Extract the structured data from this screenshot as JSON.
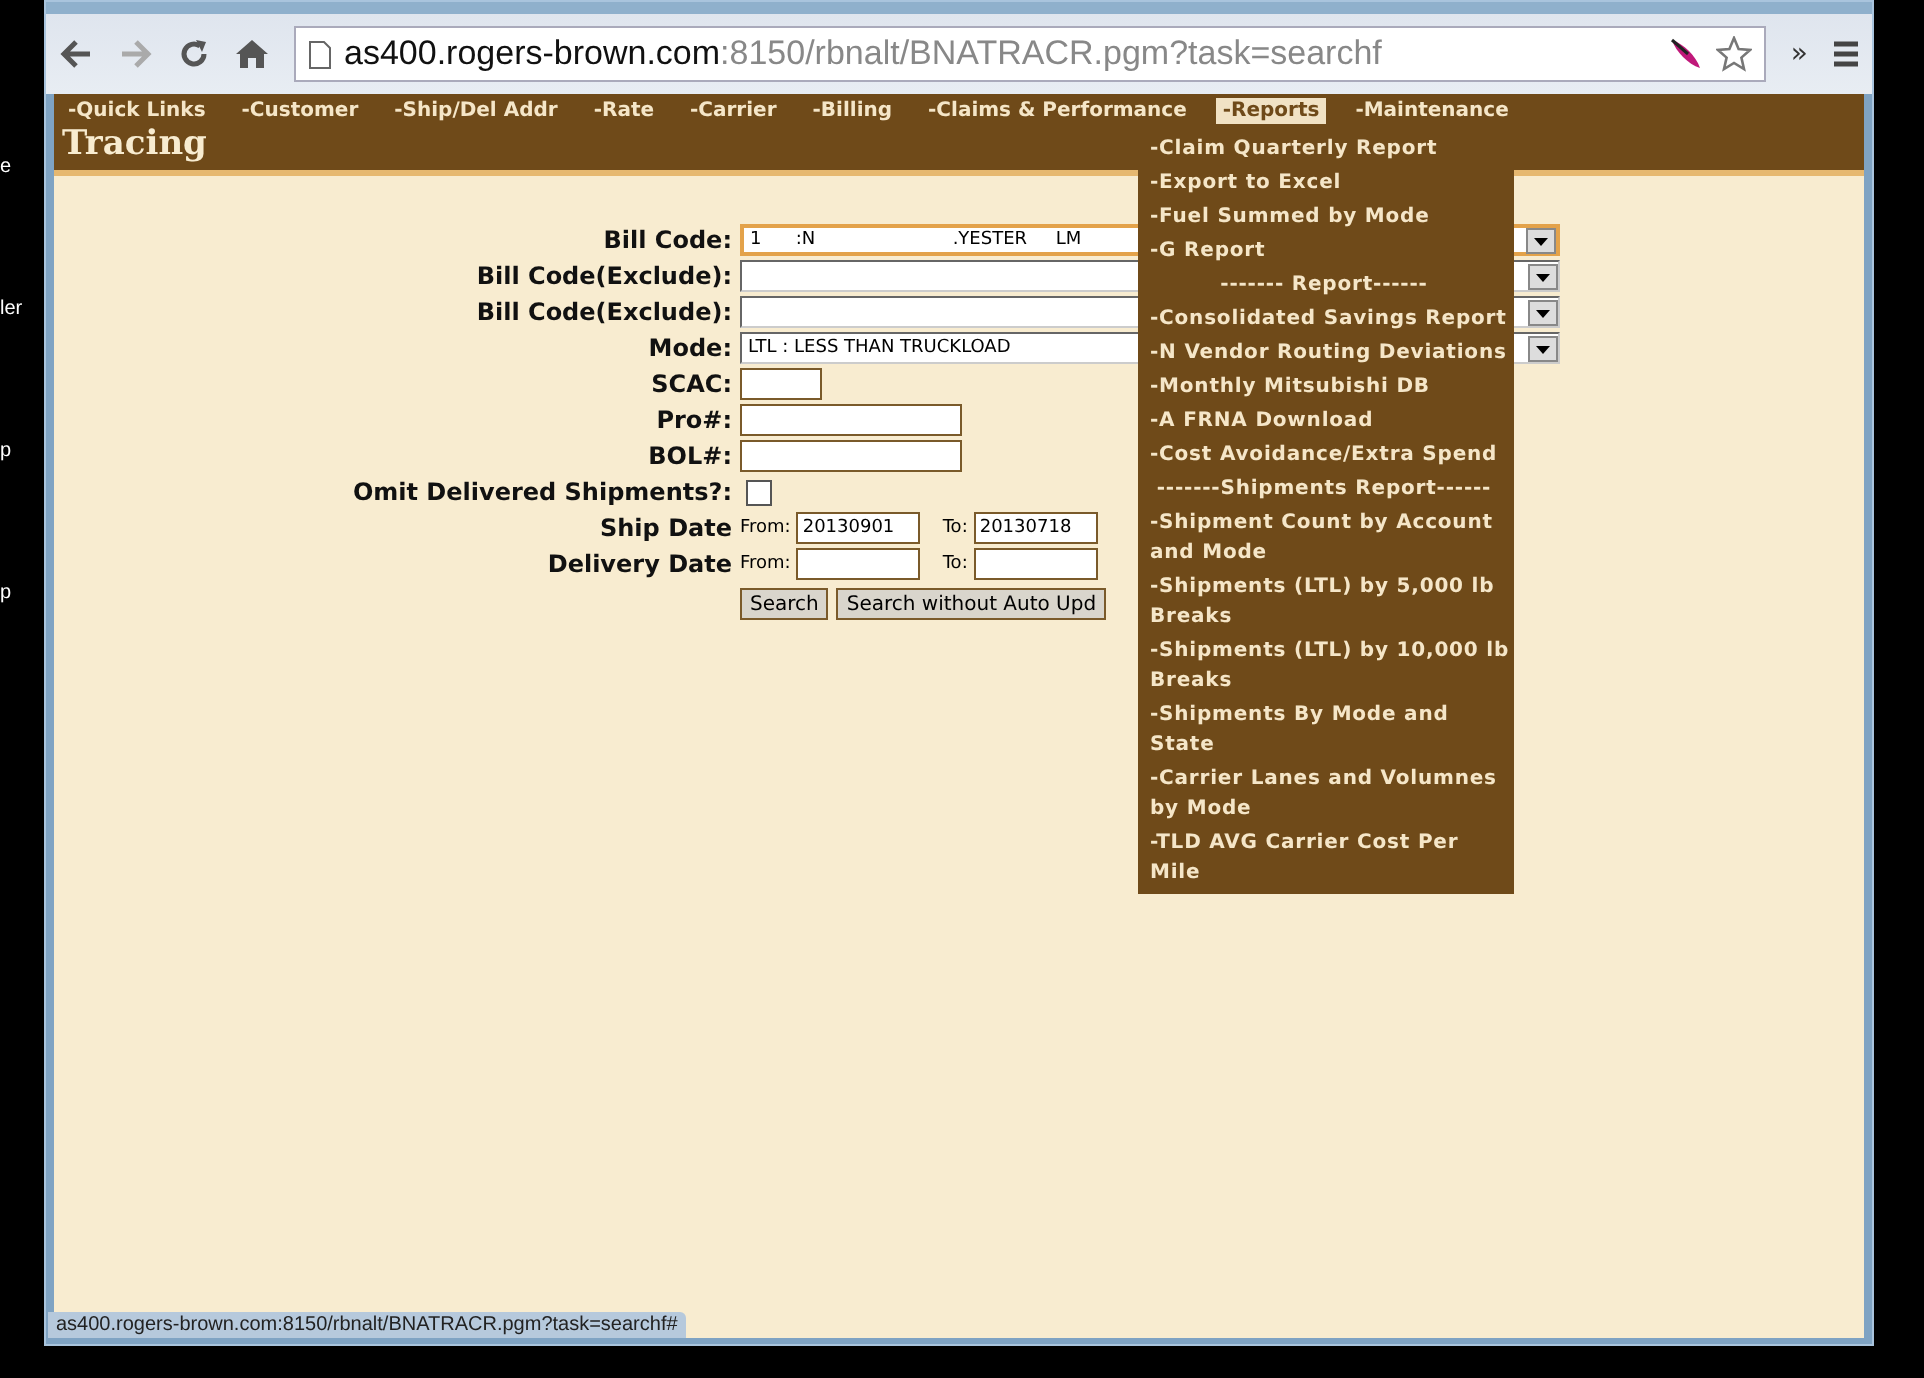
{
  "desktop": {
    "labels": [
      "e",
      "ler",
      "p",
      "p"
    ]
  },
  "browser": {
    "url_host": "as400.rogers-brown.com",
    "url_rest": ":8150/rbnalt/BNATRACR.pgm?task=searchf",
    "overflow": "»"
  },
  "nav": {
    "items": [
      {
        "label": "-Quick Links",
        "selected": false
      },
      {
        "label": "-Customer",
        "selected": false
      },
      {
        "label": "-Ship/Del Addr",
        "selected": false
      },
      {
        "label": "-Rate",
        "selected": false
      },
      {
        "label": "-Carrier",
        "selected": false
      },
      {
        "label": "-Billing",
        "selected": false
      },
      {
        "label": "-Claims & Performance",
        "selected": false
      },
      {
        "label": "-Reports",
        "selected": true
      },
      {
        "label": "-Maintenance",
        "selected": false
      }
    ]
  },
  "page_title": "Tracing",
  "form": {
    "rows": [
      {
        "kind": "select",
        "label": "Bill Code:",
        "value": "1      :N                        .YESTER     LM",
        "focused": true
      },
      {
        "kind": "select",
        "label": "Bill Code(Exclude):",
        "value": "",
        "focused": false
      },
      {
        "kind": "select",
        "label": "Bill Code(Exclude):",
        "value": "",
        "focused": false
      },
      {
        "kind": "select",
        "label": "Mode:",
        "value": "LTL : LESS THAN TRUCKLOAD",
        "focused": false
      },
      {
        "kind": "short",
        "label": "SCAC:",
        "value": ""
      },
      {
        "kind": "text",
        "label": "Pro#:",
        "value": ""
      },
      {
        "kind": "text",
        "label": "BOL#:",
        "value": ""
      },
      {
        "kind": "checkbox",
        "label": "Omit Delivered Shipments?:",
        "checked": false
      },
      {
        "kind": "daterange",
        "label": "Ship Date",
        "from_label": "From:",
        "from": "20130901",
        "to_label": "To:",
        "to": "20130718"
      },
      {
        "kind": "daterange",
        "label": "Delivery Date",
        "from_label": "From:",
        "from": "",
        "to_label": "To:",
        "to": ""
      }
    ],
    "buttons": [
      "Search",
      "Search without Auto Upd"
    ]
  },
  "reports_menu": {
    "items": [
      {
        "label": "-Claim Quarterly Report",
        "kind": "link"
      },
      {
        "label": "-Export to Excel",
        "kind": "link"
      },
      {
        "label": "-Fuel Summed by Mode",
        "kind": "link"
      },
      {
        "label": "-G            Report",
        "kind": "link"
      },
      {
        "label": "-------               Report------",
        "kind": "header"
      },
      {
        "label": "-Consolidated Savings Report",
        "kind": "link"
      },
      {
        "label": "-N               Vendor Routing Deviations",
        "kind": "link"
      },
      {
        "label": "-Monthly Mitsubishi DB",
        "kind": "link"
      },
      {
        "label": "-A          FRNA Download",
        "kind": "link"
      },
      {
        "label": "-Cost Avoidance/Extra Spend",
        "kind": "link"
      },
      {
        "label": "-------Shipments Report------",
        "kind": "header"
      },
      {
        "label": "-Shipment Count by Account and Mode",
        "kind": "link"
      },
      {
        "label": "-Shipments (LTL) by 5,000 lb Breaks",
        "kind": "link"
      },
      {
        "label": "-Shipments (LTL) by 10,000 lb Breaks",
        "kind": "link"
      },
      {
        "label": "-Shipments By Mode and State",
        "kind": "link"
      },
      {
        "label": "-Carrier Lanes and Volumnes by Mode",
        "kind": "link"
      },
      {
        "label": "-TLD AVG Carrier Cost Per Mile",
        "kind": "link"
      }
    ]
  },
  "status_bar": "as400.rogers-brown.com:8150/rbnalt/BNATRACR.pgm?task=searchf#"
}
